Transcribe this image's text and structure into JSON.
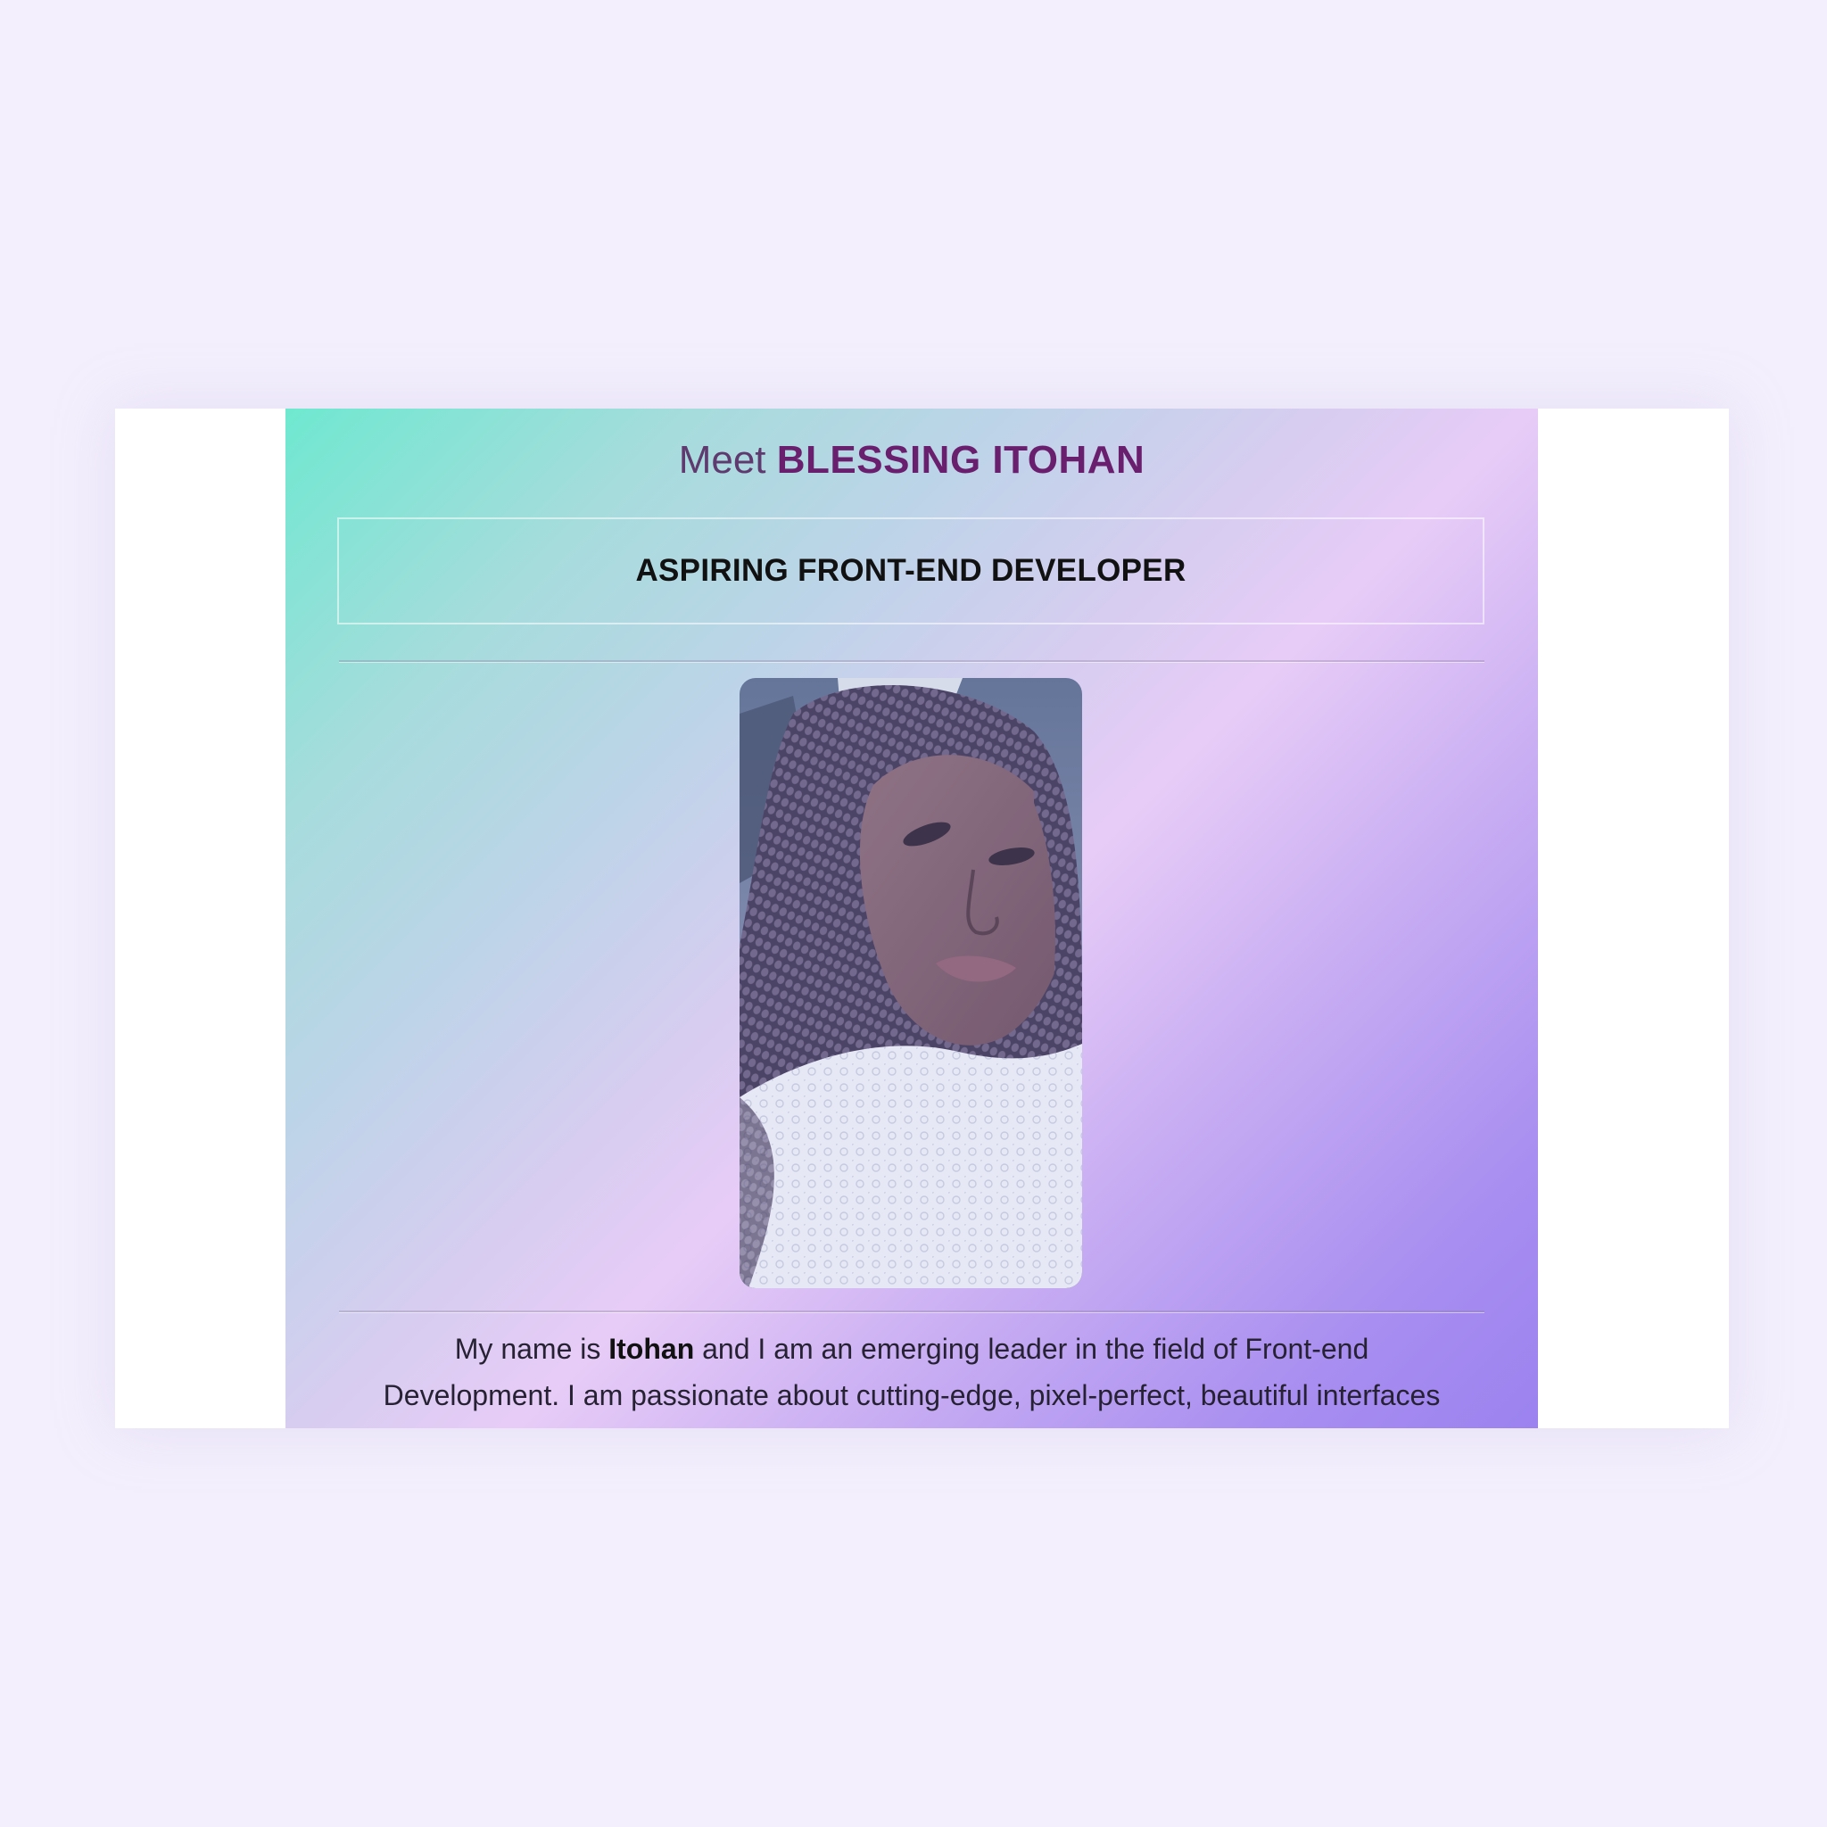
{
  "profile": {
    "headline_prefix": "Meet",
    "headline_name": "BLESSING ITOHAN",
    "role": "ASPIRING FRONT-END DEVELOPER",
    "bio_line1_before": "My name is",
    "bio_name": "Itohan",
    "bio_line1_after": "and I am an emerging leader in the field of Front-end",
    "bio_line2": "Development. I am passionate about cutting-edge, pixel-perfect, beautiful interfaces"
  },
  "colors": {
    "page_background": "#f3effc",
    "gradient_start": "#6fe8d0",
    "gradient_mid": "#e7ccf7",
    "gradient_end": "#9b82ef",
    "headline_color": "#6a1f6e"
  },
  "photo": {
    "icon": "profile-photo"
  }
}
